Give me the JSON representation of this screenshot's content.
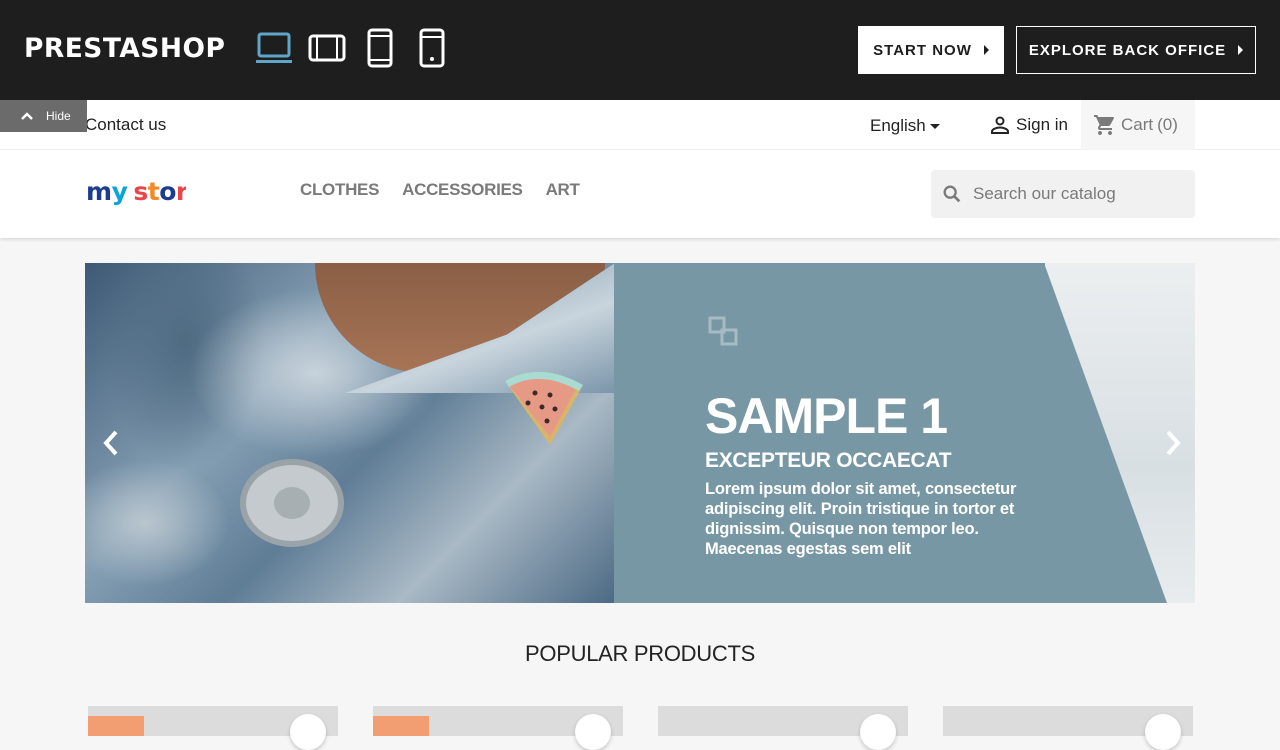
{
  "demo_bar": {
    "logo": "PRESTASHOP",
    "devices": [
      {
        "name": "laptop",
        "active": true
      },
      {
        "name": "tablet-landscape",
        "active": false
      },
      {
        "name": "tablet-portrait",
        "active": false
      },
      {
        "name": "mobile",
        "active": false
      }
    ],
    "start_label": "START NOW",
    "explore_label": "EXPLORE BACK OFFICE",
    "active_color": "#5fa6c8"
  },
  "header": {
    "hide_label": "Hide",
    "contact": "Contact us",
    "language": "English",
    "signin": "Sign in",
    "cart_label": "Cart",
    "cart_count": "(0)",
    "logo": "my store",
    "menu": [
      "CLOTHES",
      "ACCESSORIES",
      "ART"
    ],
    "search_placeholder": "Search our catalog"
  },
  "slider": {
    "title": "SAMPLE 1",
    "subtitle": "EXCEPTEUR OCCAECAT",
    "text": "Lorem ipsum dolor sit amet, consectetur adipiscing elit. Proin tristique in tortor et dignissim. Quisque non tempor leo. Maecenas egestas sem elit",
    "bg_color": "#7897a4"
  },
  "products": {
    "heading": "POPULAR PRODUCTS"
  }
}
